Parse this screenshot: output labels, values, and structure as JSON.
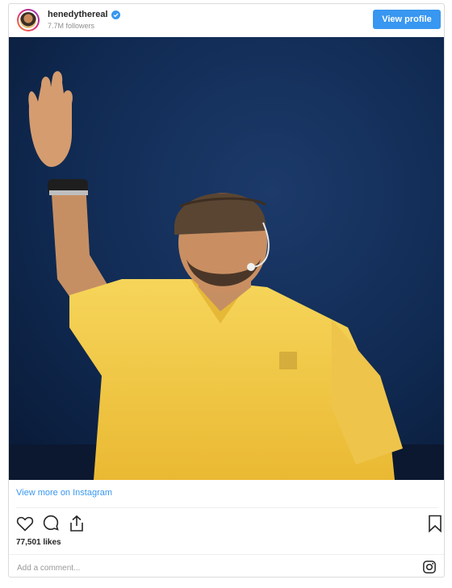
{
  "header": {
    "username": "henedythereal",
    "followers": "7.7M followers",
    "view_profile_label": "View profile",
    "verified_icon": "verified-badge-icon",
    "avatar": "profile-avatar"
  },
  "post": {
    "image": "photo of a man in a yellow shirt and cap waving with a headset microphone"
  },
  "view_more_label": "View more on Instagram",
  "actions": {
    "icons": [
      "heart-icon",
      "comment-icon",
      "share-icon",
      "bookmark-icon"
    ]
  },
  "likes": "77,501 likes",
  "comment": {
    "placeholder": "Add a comment..."
  },
  "colors": {
    "accent": "#3897f0",
    "background_dark_blue": "#10254a",
    "shirt_yellow": "#f2c94c"
  }
}
